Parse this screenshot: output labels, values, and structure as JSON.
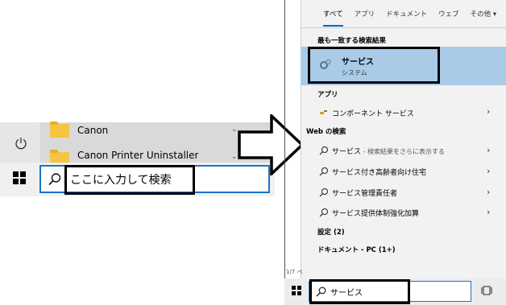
{
  "left": {
    "apps": [
      {
        "label": "Canon"
      },
      {
        "label": "Canon Printer Uninstaller"
      }
    ],
    "search": {
      "value": "ここに入力して検索"
    }
  },
  "right": {
    "tabs": [
      "すべて",
      "アプリ",
      "ドキュメント",
      "ウェブ",
      "その他 ▾"
    ],
    "best_match_heading": "最も一致する検索結果",
    "best_match": {
      "title": "サービス",
      "subtitle": "システム"
    },
    "apps_heading": "アプリ",
    "app_result": "コンポーネント サービス",
    "web_heading": "Web の検索",
    "web_results": [
      {
        "text": "サービス",
        "hint": " - 検索結果をさらに表示する"
      },
      {
        "text": "サービス付き高齢者向け住宅",
        "hint": ""
      },
      {
        "text": "サービス管理責任者",
        "hint": ""
      },
      {
        "text": "サービス提供体制強化加算",
        "hint": ""
      }
    ],
    "settings_heading": "設定 (2)",
    "documents_heading": "ドキュメント - PC (1+)",
    "pager": "1/7 ペ",
    "search": {
      "value": "サービス"
    }
  },
  "colors": {
    "accent": "#1a73c8",
    "selected_row": "#a9cbe8",
    "tab_underline": "#0067c0"
  }
}
